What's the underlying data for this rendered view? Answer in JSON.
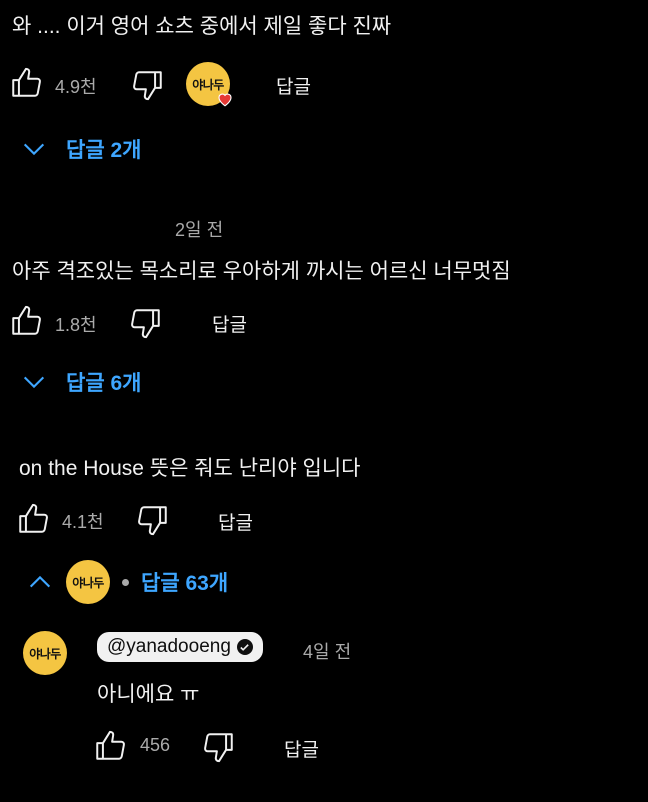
{
  "comments": [
    {
      "text": "와 .... 이거 영어 쇼츠 중에서 제일 좋다 진짜",
      "likes": "4.9천",
      "reply_label": "답글",
      "creator_avatar_text": "야나두",
      "replies_toggle": "답글 2개"
    },
    {
      "time": "2일 전",
      "text": "아주 격조있는 목소리로 우아하게 까시는 어르신 너무멋짐",
      "likes": "1.8천",
      "reply_label": "답글",
      "replies_toggle": "답글 6개"
    },
    {
      "text": "on the House 뜻은 줘도 난리야 입니다",
      "likes": "4.1천",
      "reply_label": "답글",
      "creator_avatar_text": "야나두",
      "replies_toggle": "답글 63개"
    }
  ],
  "reply": {
    "avatar_text": "야나두",
    "handle": "@yanadooeng",
    "time": "4일 전",
    "text": "아니에요 ㅠ",
    "likes": "456",
    "reply_label": "답글"
  },
  "colors": {
    "accent": "#3ea6ff",
    "avatar": "#f4c542",
    "heart": "#e53935"
  }
}
